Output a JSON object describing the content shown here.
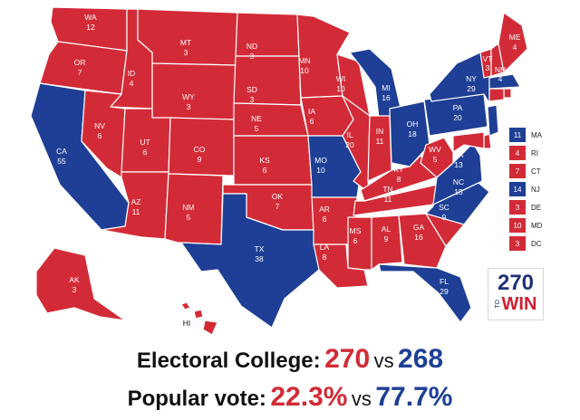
{
  "colors": {
    "republican": "#d22b37",
    "democrat": "#1e3f95",
    "border": "#ffffff"
  },
  "states": [
    {
      "abbr": "WA",
      "ev": "12",
      "party": "R"
    },
    {
      "abbr": "OR",
      "ev": "7",
      "party": "R"
    },
    {
      "abbr": "CA",
      "ev": "55",
      "party": "D"
    },
    {
      "abbr": "ID",
      "ev": "4",
      "party": "R"
    },
    {
      "abbr": "NV",
      "ev": "6",
      "party": "R"
    },
    {
      "abbr": "MT",
      "ev": "3",
      "party": "R"
    },
    {
      "abbr": "WY",
      "ev": "3",
      "party": "R"
    },
    {
      "abbr": "UT",
      "ev": "6",
      "party": "R"
    },
    {
      "abbr": "AZ",
      "ev": "11",
      "party": "R"
    },
    {
      "abbr": "CO",
      "ev": "9",
      "party": "R"
    },
    {
      "abbr": "NM",
      "ev": "5",
      "party": "R"
    },
    {
      "abbr": "ND",
      "ev": "3",
      "party": "R"
    },
    {
      "abbr": "SD",
      "ev": "3",
      "party": "R"
    },
    {
      "abbr": "NE",
      "ev": "5",
      "party": "R"
    },
    {
      "abbr": "KS",
      "ev": "6",
      "party": "R"
    },
    {
      "abbr": "OK",
      "ev": "7",
      "party": "R"
    },
    {
      "abbr": "TX",
      "ev": "38",
      "party": "D"
    },
    {
      "abbr": "MN",
      "ev": "10",
      "party": "R"
    },
    {
      "abbr": "IA",
      "ev": "6",
      "party": "R"
    },
    {
      "abbr": "MO",
      "ev": "10",
      "party": "D"
    },
    {
      "abbr": "AR",
      "ev": "6",
      "party": "R"
    },
    {
      "abbr": "LA",
      "ev": "8",
      "party": "R"
    },
    {
      "abbr": "WI",
      "ev": "10",
      "party": "R"
    },
    {
      "abbr": "IL",
      "ev": "20",
      "party": "R"
    },
    {
      "abbr": "MI",
      "ev": "16",
      "party": "D"
    },
    {
      "abbr": "IN",
      "ev": "11",
      "party": "R"
    },
    {
      "abbr": "OH",
      "ev": "18",
      "party": "D"
    },
    {
      "abbr": "KY",
      "ev": "8",
      "party": "R"
    },
    {
      "abbr": "TN",
      "ev": "11",
      "party": "R"
    },
    {
      "abbr": "MS",
      "ev": "6",
      "party": "R"
    },
    {
      "abbr": "AL",
      "ev": "9",
      "party": "R"
    },
    {
      "abbr": "GA",
      "ev": "16",
      "party": "R"
    },
    {
      "abbr": "FL",
      "ev": "29",
      "party": "D"
    },
    {
      "abbr": "SC",
      "ev": "9",
      "party": "R"
    },
    {
      "abbr": "NC",
      "ev": "15",
      "party": "D"
    },
    {
      "abbr": "VA",
      "ev": "13",
      "party": "D"
    },
    {
      "abbr": "WV",
      "ev": "5",
      "party": "R"
    },
    {
      "abbr": "PA",
      "ev": "20",
      "party": "D"
    },
    {
      "abbr": "NY",
      "ev": "29",
      "party": "D"
    },
    {
      "abbr": "VT",
      "ev": "3",
      "party": "R"
    },
    {
      "abbr": "NH",
      "ev": "4",
      "party": "R"
    },
    {
      "abbr": "ME",
      "ev": "4",
      "party": "R"
    },
    {
      "abbr": "AK",
      "ev": "3",
      "party": "R"
    },
    {
      "abbr": "HI",
      "ev": "",
      "party": "R"
    }
  ],
  "legend": [
    {
      "ev": "11",
      "abbr": "MA",
      "party": "D"
    },
    {
      "ev": "4",
      "abbr": "RI",
      "party": "R"
    },
    {
      "ev": "7",
      "abbr": "CT",
      "party": "R"
    },
    {
      "ev": "14",
      "abbr": "NJ",
      "party": "D"
    },
    {
      "ev": "3",
      "abbr": "DE",
      "party": "R"
    },
    {
      "ev": "10",
      "abbr": "MD",
      "party": "R"
    },
    {
      "ev": "3",
      "abbr": "DC",
      "party": "R"
    }
  ],
  "logo": {
    "top": "270",
    "middle": "TO",
    "bottom": "WIN"
  },
  "summary": {
    "electoral_label": "Electoral College:",
    "electoral_red": "270",
    "electoral_vs": "vs",
    "electoral_blue": "268",
    "popular_label": "Popular vote:",
    "popular_red": "22.3%",
    "popular_vs": "vs",
    "popular_blue": "77.7%"
  }
}
